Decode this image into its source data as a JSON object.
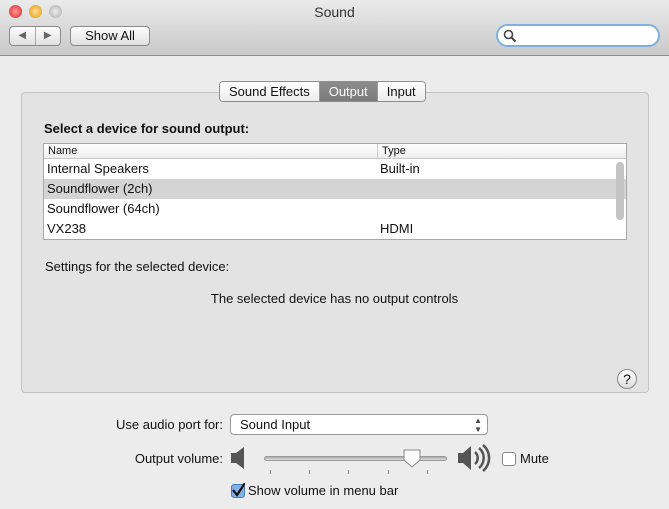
{
  "window": {
    "title": "Sound"
  },
  "toolbar": {
    "back": "◀",
    "forward": "▶",
    "show_all": "Show All",
    "search_placeholder": ""
  },
  "tabs": [
    {
      "label": "Sound Effects",
      "active": false
    },
    {
      "label": "Output",
      "active": true
    },
    {
      "label": "Input",
      "active": false
    }
  ],
  "output": {
    "heading": "Select a device for sound output:",
    "columns": [
      "Name",
      "Type"
    ],
    "devices": [
      {
        "name": "Internal Speakers",
        "type": "Built-in",
        "selected": false
      },
      {
        "name": "Soundflower (2ch)",
        "type": "",
        "selected": true
      },
      {
        "name": "Soundflower (64ch)",
        "type": "",
        "selected": false
      },
      {
        "name": "VX238",
        "type": "HDMI",
        "selected": false
      }
    ],
    "settings_label": "Settings for the selected device:",
    "no_controls": "The selected device has no output controls",
    "help": "?"
  },
  "bottom": {
    "audio_port_label": "Use audio port for:",
    "audio_port_value": "Sound Input",
    "volume_label": "Output volume:",
    "volume_level": 0.81,
    "mute_label": "Mute",
    "mute_checked": false,
    "menu_bar_label": "Show volume in menu bar",
    "menu_bar_checked": true
  }
}
